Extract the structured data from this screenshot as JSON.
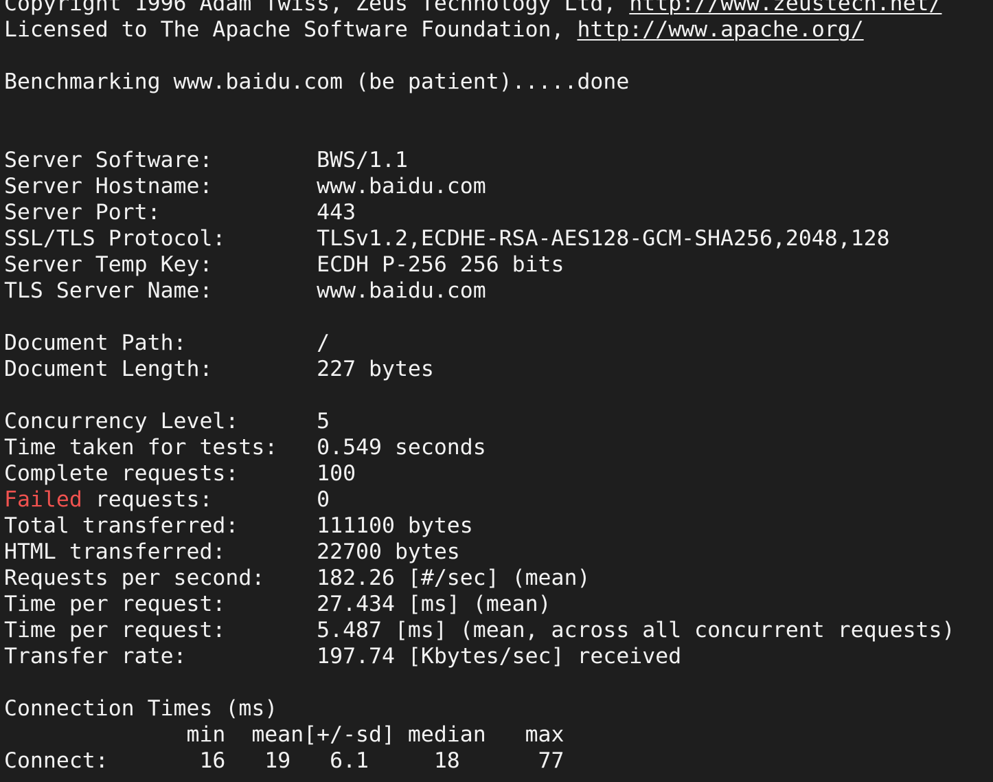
{
  "colors": {
    "background": "#1e1e1e",
    "foreground": "#f2f2f2",
    "highlight_red": "#f0524f"
  },
  "header": {
    "copyright_prefix": "Copyright 1996 Adam Twiss, Zeus Technology Ltd, ",
    "copyright_link": "http://www.zeustech.net/",
    "license_prefix": "Licensed to The Apache Software Foundation, ",
    "license_link": "http://www.apache.org/",
    "benchmark_line": "Benchmarking www.baidu.com (be patient).....done"
  },
  "server": {
    "software_label": "Server Software:        ",
    "software_value": "BWS/1.1",
    "hostname_label": "Server Hostname:        ",
    "hostname_value": "www.baidu.com",
    "port_label": "Server Port:            ",
    "port_value": "443",
    "ssl_label": "SSL/TLS Protocol:       ",
    "ssl_value": "TLSv1.2,ECDHE-RSA-AES128-GCM-SHA256,2048,128",
    "tempkey_label": "Server Temp Key:        ",
    "tempkey_value": "ECDH P-256 256 bits",
    "tls_name_label": "TLS Server Name:        ",
    "tls_name_value": "www.baidu.com"
  },
  "document": {
    "path_label": "Document Path:          ",
    "path_value": "/",
    "length_label": "Document Length:        ",
    "length_value": "227 bytes"
  },
  "results": {
    "concurrency_label": "Concurrency Level:      ",
    "concurrency_value": "5",
    "time_taken_label": "Time taken for tests:   ",
    "time_taken_value": "0.549 seconds",
    "complete_label": "Complete requests:      ",
    "complete_value": "100",
    "failed_word": "Failed",
    "failed_rest": " requests:        ",
    "failed_value": "0",
    "total_transferred_label": "Total transferred:      ",
    "total_transferred_value": "111100 bytes",
    "html_transferred_label": "HTML transferred:       ",
    "html_transferred_value": "22700 bytes",
    "rps_label": "Requests per second:    ",
    "rps_value": "182.26 [#/sec] (mean)",
    "tpr_label": "Time per request:       ",
    "tpr_value": "27.434 [ms] (mean)",
    "tpr2_label": "Time per request:       ",
    "tpr2_value": "5.487 [ms] (mean, across all concurrent requests)",
    "transfer_rate_label": "Transfer rate:          ",
    "transfer_rate_value": "197.74 [Kbytes/sec] received"
  },
  "connection_times": {
    "title": "Connection Times (ms)",
    "header_line": "              min  mean[+/-sd] median   max",
    "connect_line": "Connect:       16   19   6.1     18      77"
  }
}
